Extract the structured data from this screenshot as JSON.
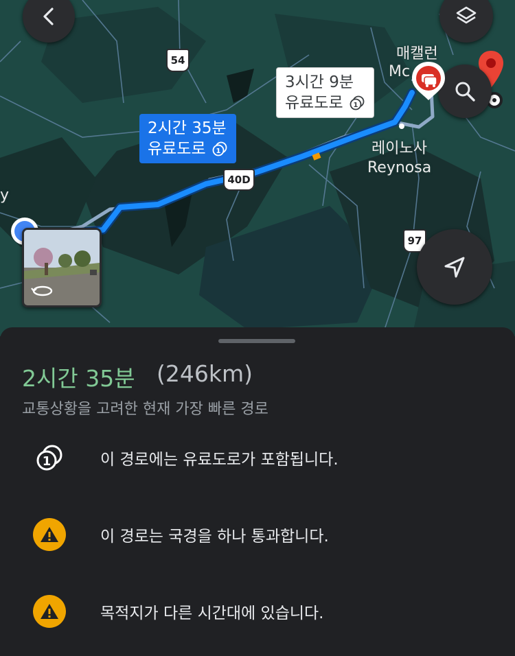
{
  "map": {
    "primary_route": {
      "duration": "2시간 35분",
      "tag": "유료도로"
    },
    "alt_route": {
      "duration": "3시간 9분",
      "tag": "유료도로"
    },
    "city_labels": {
      "mcallen_ko": "매캘런",
      "mcallen_partial": "Mc",
      "reynosa_ko": "레이노사",
      "reynosa_en": "Reynosa",
      "left_edge": "y"
    },
    "shields": {
      "s54": "54",
      "s40d": "40D",
      "s97": "97"
    },
    "icons": [
      "back-arrow-icon",
      "layers-icon",
      "search-icon",
      "navigation-icon",
      "destination-pin-icon",
      "traffic-car-icon",
      "toll-icon",
      "street-view-rotate-icon"
    ]
  },
  "sheet": {
    "duration": "2시간 35분",
    "distance": "(246km)",
    "subtitle": "교통상황을 고려한 현재 가장 빠른 경로",
    "notices": [
      {
        "icon": "toll-icon",
        "text": "이 경로에는 유료도로가 포함됩니다."
      },
      {
        "icon": "warning-icon",
        "text": "이 경로는 국경을 하나 통과합니다."
      },
      {
        "icon": "warning-icon",
        "text": "목적지가 다른 시간대에 있습니다."
      }
    ]
  },
  "colors": {
    "route_primary": "#1a8cff",
    "route_alt": "#8fa9c6",
    "duration_green": "#81c995",
    "warning": "#f0a500",
    "sheet_bg": "#202124",
    "map_bg": "#1f4a45"
  }
}
